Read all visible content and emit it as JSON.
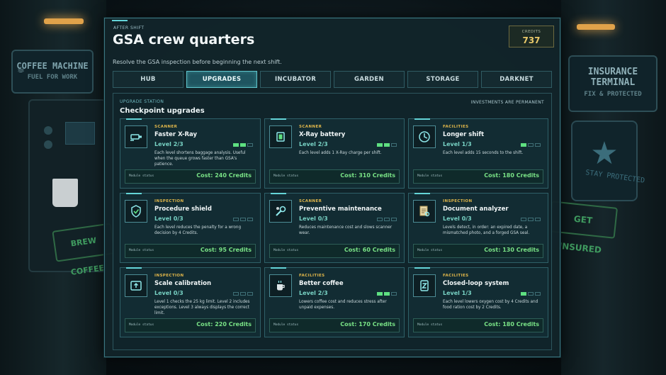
{
  "background": {
    "coffee_sign": {
      "title": "COFFEE MACHINE",
      "subtitle": "FUEL FOR WORK",
      "icon": "coffee-cup-icon"
    },
    "coffee_button": "BREW COFFEE",
    "insurance_sign": {
      "title": "INSURANCE TERMINAL",
      "subtitle": "FIX & PROTECTED"
    },
    "insurance_tagline": "STAY PROTECTED",
    "insurance_button": "GET INSURED"
  },
  "header": {
    "kicker": "AFTER SHIFT",
    "title": "GSA crew quarters",
    "subtitle": "Resolve the GSA inspection before beginning the next shift."
  },
  "credits": {
    "label": "CREDITS",
    "value": "737"
  },
  "tabs": [
    {
      "label": "HUB",
      "active": false
    },
    {
      "label": "UPGRADES",
      "active": true
    },
    {
      "label": "INCUBATOR",
      "active": false
    },
    {
      "label": "GARDEN",
      "active": false
    },
    {
      "label": "STORAGE",
      "active": false
    },
    {
      "label": "DARKNET",
      "active": false
    }
  ],
  "station": {
    "kicker": "UPGRADE STATION",
    "title": "Checkpoint upgrades",
    "note": "INVESTMENTS ARE PERMANENT"
  },
  "colors": {
    "accent": "#64d5d8",
    "category": "#e0b64a",
    "cost": "#79e286",
    "credits": "#e9c96a"
  },
  "cards": [
    {
      "icon": "xray-gun-icon",
      "category": "SCANNER",
      "name": "Faster X-Ray",
      "level": "Level 2/3",
      "level_current": 2,
      "level_max": 3,
      "desc": "Each level shortens baggage analysis. Useful when the queue grows faster than GSA's patience.",
      "status": "Module status",
      "cost": "Cost: 240 Credits"
    },
    {
      "icon": "battery-chip-icon",
      "category": "SCANNER",
      "name": "X-Ray battery",
      "level": "Level 2/3",
      "level_current": 2,
      "level_max": 3,
      "desc": "Each level adds 1 X-Ray charge per shift.",
      "status": "Module status",
      "cost": "Cost: 310 Credits"
    },
    {
      "icon": "clock-icon",
      "category": "FACILITIES",
      "name": "Longer shift",
      "level": "Level 1/3",
      "level_current": 1,
      "level_max": 3,
      "desc": "Each level adds 15 seconds to the shift.",
      "status": "Module status",
      "cost": "Cost: 180 Credits"
    },
    {
      "icon": "shield-check-icon",
      "category": "INSPECTION",
      "name": "Procedure shield",
      "level": "Level 0/3",
      "level_current": 0,
      "level_max": 3,
      "desc": "Each level reduces the penalty for a wrong decision by 4 Credits.",
      "status": "Module status",
      "cost": "Cost: 95 Credits"
    },
    {
      "icon": "wrench-icon",
      "category": "SCANNER",
      "name": "Preventive maintenance",
      "level": "Level 0/3",
      "level_current": 0,
      "level_max": 3,
      "desc": "Reduces maintenance cost and slows scanner wear.",
      "status": "Module status",
      "cost": "Cost: 60 Credits"
    },
    {
      "icon": "document-search-icon",
      "category": "INSPECTION",
      "name": "Document analyzer",
      "level": "Level 0/3",
      "level_current": 0,
      "level_max": 3,
      "desc": "Levels detect, in order: an expired date, a mismatched photo, and a forged GSA seal.",
      "status": "Module status",
      "cost": "Cost: 130 Credits"
    },
    {
      "icon": "scale-icon",
      "category": "INSPECTION",
      "name": "Scale calibration",
      "level": "Level 0/3",
      "level_current": 0,
      "level_max": 3,
      "desc": "Level 1 checks the 25 kg limit. Level 2 includes exceptions. Level 3 always displays the correct limit.",
      "status": "Module status",
      "cost": "Cost: 220 Credits"
    },
    {
      "icon": "coffee-cup-icon",
      "category": "FACILITIES",
      "name": "Better coffee",
      "level": "Level 2/3",
      "level_current": 2,
      "level_max": 3,
      "desc": "Lowers coffee cost and reduces stress after unpaid expenses.",
      "status": "Module status",
      "cost": "Cost: 170 Credits"
    },
    {
      "icon": "recycle-icon",
      "category": "FACILITIES",
      "name": "Closed-loop system",
      "level": "Level 1/3",
      "level_current": 1,
      "level_max": 3,
      "desc": "Each level lowers oxygen cost by 4 Credits and food ration cost by 2 Credits.",
      "status": "Module status",
      "cost": "Cost: 180 Credits"
    }
  ]
}
